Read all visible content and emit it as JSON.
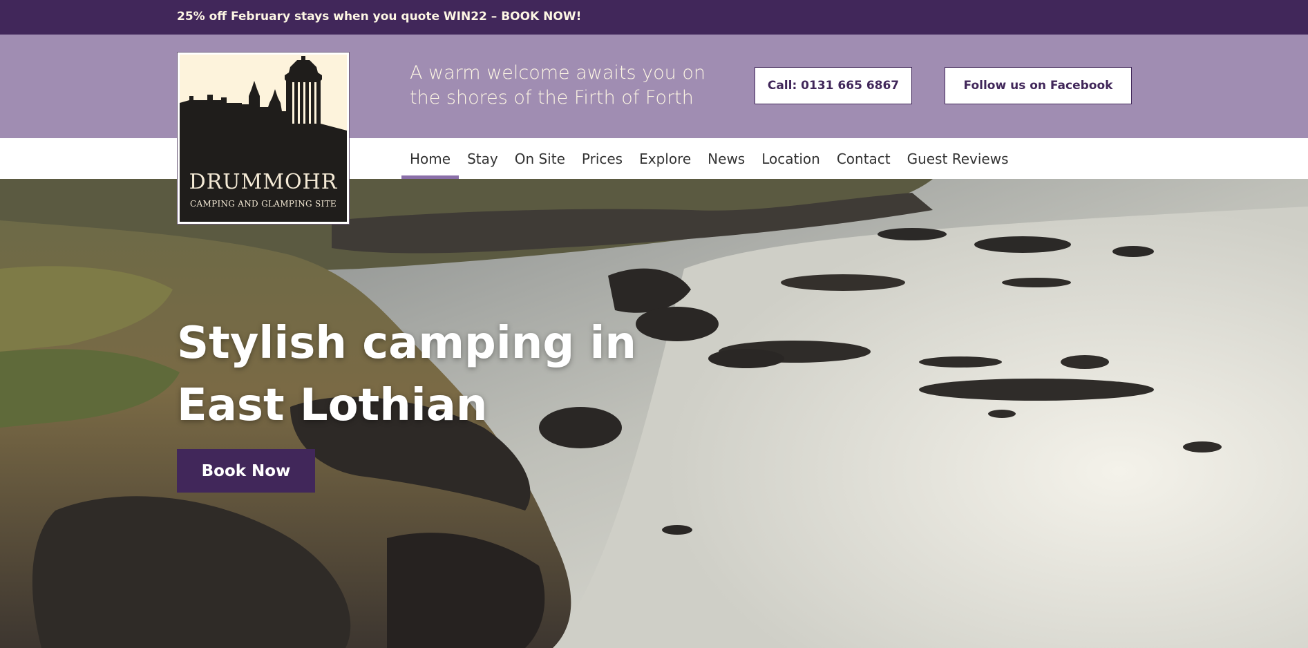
{
  "promo": {
    "text": "25% off February stays when you quote WIN22 – BOOK NOW!"
  },
  "header": {
    "tagline": "A warm welcome awaits you on the shores of the Firth of Forth",
    "call_label": "Call: 0131 665 6867",
    "facebook_label": "Follow us on Facebook"
  },
  "logo": {
    "name": "DRUMMOHR",
    "subtitle": "CAMPING AND GLAMPING SITE"
  },
  "nav": {
    "items": [
      {
        "label": "Home",
        "active": true
      },
      {
        "label": "Stay"
      },
      {
        "label": "On Site"
      },
      {
        "label": "Prices"
      },
      {
        "label": "Explore"
      },
      {
        "label": "News"
      },
      {
        "label": "Location"
      },
      {
        "label": "Contact"
      },
      {
        "label": "Guest Reviews"
      }
    ]
  },
  "hero": {
    "title": "Stylish camping in East Lothian",
    "button_label": "Book Now",
    "image": "coastline-aerial-photo"
  },
  "colors": {
    "brand_purple": "#41275a",
    "header_lilac": "#a08db2",
    "cream": "#fdf6e4",
    "nav_active": "#8a6fa8"
  }
}
